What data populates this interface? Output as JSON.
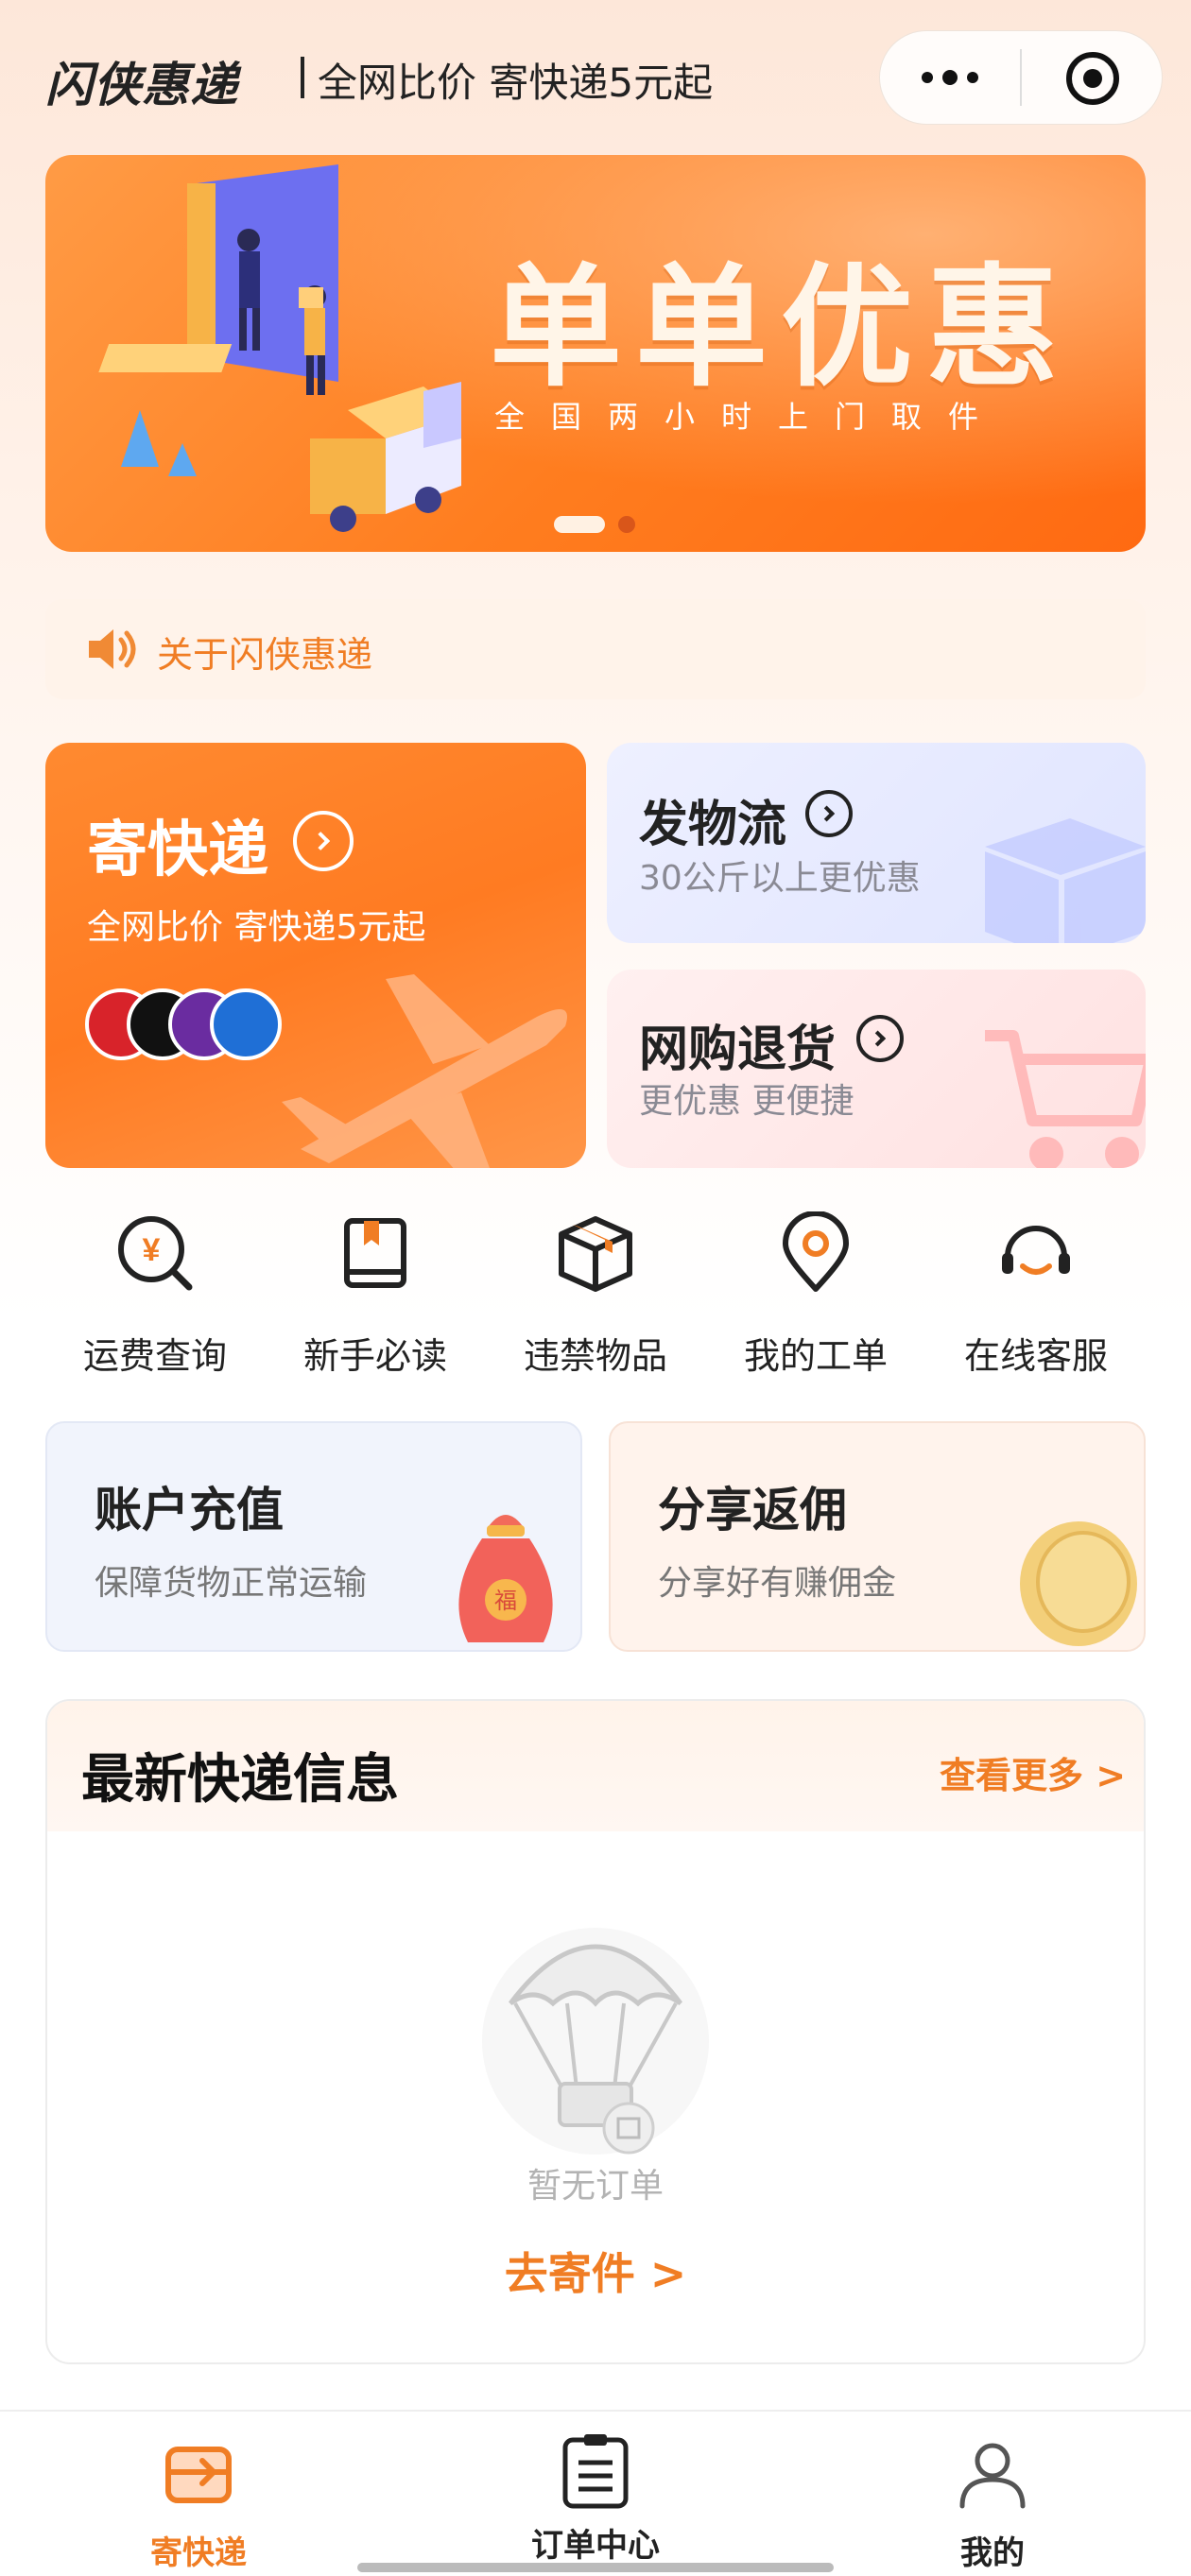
{
  "header": {
    "brand": "闪侠惠递",
    "slogan": "全网比价 寄快递5元起"
  },
  "banner": {
    "title": "单单优惠",
    "subtitle": "全国两小时上门取件",
    "active_slide": 1,
    "slide_count": 2
  },
  "notice": {
    "text": "关于闪侠惠递"
  },
  "services": {
    "express": {
      "title": "寄快递",
      "subtitle": "全网比价 寄快递5元起"
    },
    "logistics": {
      "title": "发物流",
      "subtitle": "30公斤以上更优惠"
    },
    "returns": {
      "title": "网购退货",
      "subtitle": "更优惠 更便捷"
    }
  },
  "quick_menu": [
    {
      "label": "运费查询",
      "icon": "yen-search-icon"
    },
    {
      "label": "新手必读",
      "icon": "book-icon"
    },
    {
      "label": "违禁物品",
      "icon": "box-icon"
    },
    {
      "label": "我的工单",
      "icon": "location-pin-icon"
    },
    {
      "label": "在线客服",
      "icon": "headset-icon"
    }
  ],
  "promo_cards": {
    "topup": {
      "title": "账户充值",
      "subtitle": "保障货物正常运输"
    },
    "share": {
      "title": "分享返佣",
      "subtitle": "分享好有赚佣金"
    }
  },
  "latest": {
    "title": "最新快递信息",
    "more_label": "查看更多 >",
    "empty_text": "暂无订单",
    "action_label": "去寄件 >"
  },
  "tabbar": [
    {
      "label": "寄快递",
      "icon": "send-parcel-icon",
      "active": true
    },
    {
      "label": "订单中心",
      "icon": "clipboard-icon",
      "active": false
    },
    {
      "label": "我的",
      "icon": "user-icon",
      "active": false
    }
  ],
  "colors": {
    "accent": "#f07d24",
    "banner": "#ff7d1f",
    "text": "#222222",
    "muted": "#8a8a94"
  }
}
